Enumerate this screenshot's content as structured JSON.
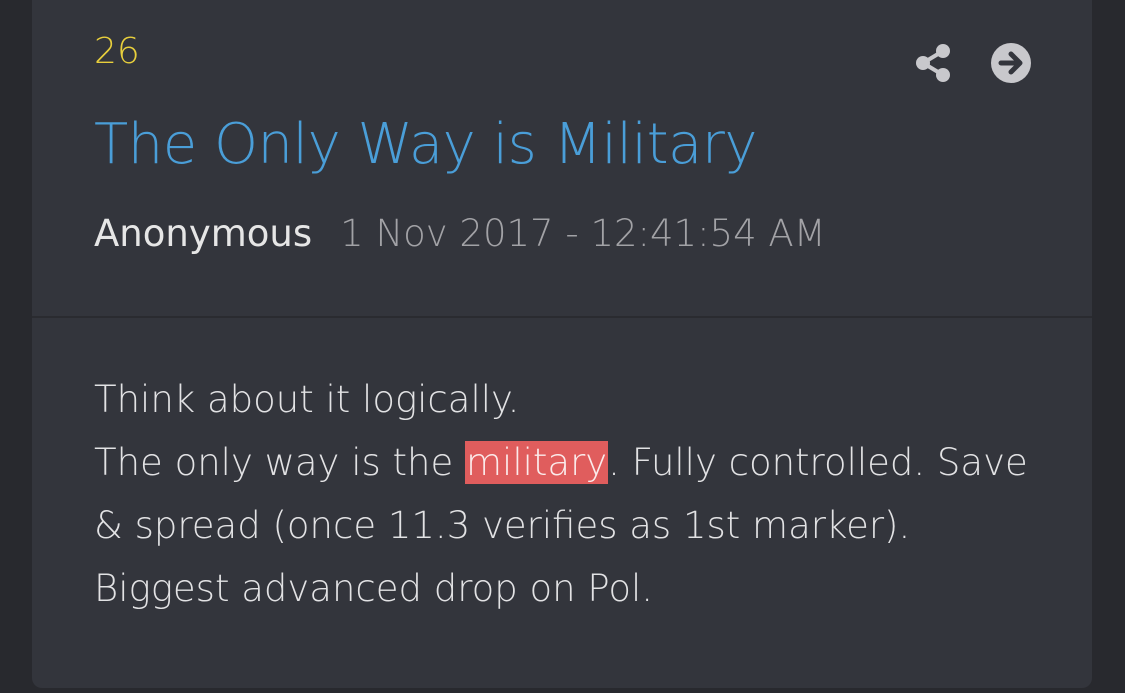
{
  "post": {
    "number": "26",
    "title": "The Only Way is Military",
    "author": "Anonymous",
    "date": "1 Nov 2017 - 12:41:54 AM",
    "body": {
      "line1": "Think about it logically.",
      "line2_pre": "The only way is the ",
      "line2_highlight": "military",
      "line2_post": ". Fully controlled. Save & spread (once 11.3 verifies as 1st marker).",
      "line3": "Biggest advanced drop on Pol."
    }
  },
  "icons": {
    "share": "share-icon",
    "open": "arrow-right-circle-icon"
  },
  "colors": {
    "background": "#28292e",
    "card": "#33353c",
    "post_number": "#e8cf3c",
    "title": "#4a9ed8",
    "highlight": "#e05d5d",
    "icon": "#c8c8cc"
  }
}
